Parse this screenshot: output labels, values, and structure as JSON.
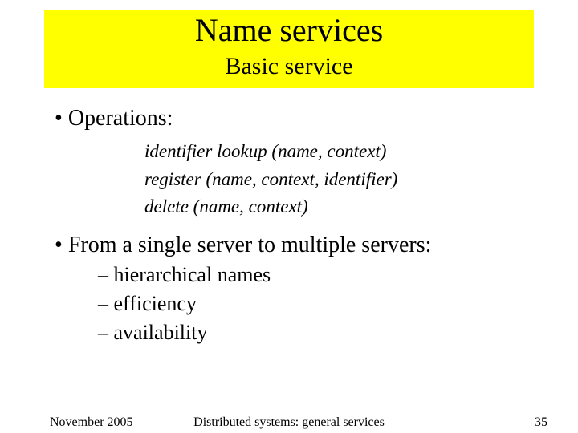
{
  "title": "Name services",
  "subtitle": "Basic service",
  "bullets": {
    "operations_label": "Operations:",
    "ops": [
      "identifier lookup (name, context)",
      "register (name, context, identifier)",
      "delete (name, context)"
    ],
    "multiservers_label": "From a single server to multiple servers:",
    "subitems": [
      "hierarchical names",
      "efficiency",
      "availability"
    ]
  },
  "footer": {
    "date": "November 2005",
    "center": "Distributed systems: general services",
    "page": "35"
  }
}
